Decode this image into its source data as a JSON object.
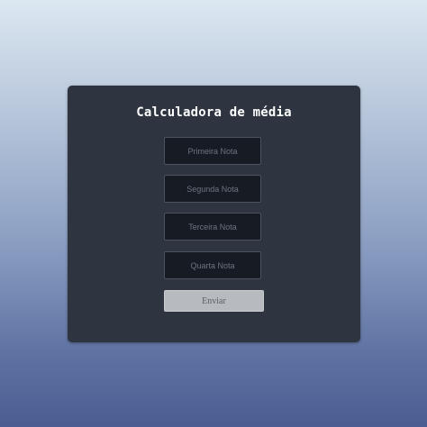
{
  "form": {
    "title": "Calculadora de média",
    "fields": [
      {
        "placeholder": "Primeira Nota",
        "value": ""
      },
      {
        "placeholder": "Segunda Nota",
        "value": ""
      },
      {
        "placeholder": "Terceira Nota",
        "value": ""
      },
      {
        "placeholder": "Quarta Nota",
        "value": ""
      }
    ],
    "submit_label": "Enviar"
  },
  "colors": {
    "card_background": "#2e3541",
    "input_background": "#171b23",
    "button_background": "#b7babf",
    "title_text": "#ffffff"
  }
}
